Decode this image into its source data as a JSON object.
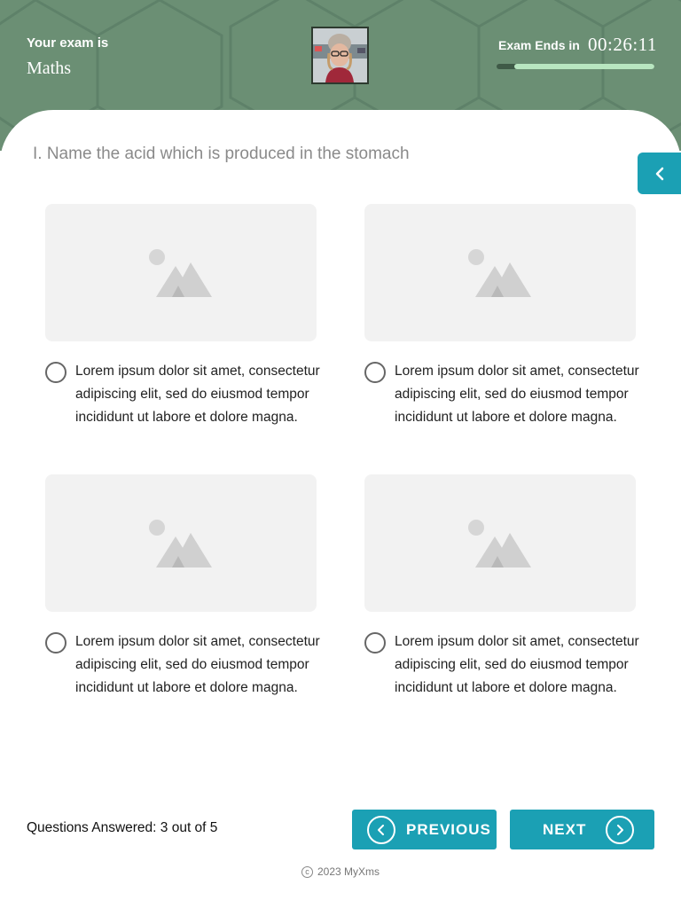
{
  "header": {
    "exam_label": "Your exam is",
    "exam_subject": "Maths",
    "timer_label": "Exam Ends in",
    "timer_value": "00:26:11",
    "time_remaining_fraction": 0.89,
    "avatar_icon": "user-photo"
  },
  "question": {
    "text": "I. Name the acid which is produced in the stomach"
  },
  "options": [
    {
      "text": "Lorem ipsum dolor sit amet, consectetur adipiscing elit, sed do eiusmod tempor incididunt ut labore et dolore magna.",
      "image_icon": "image-placeholder-icon"
    },
    {
      "text": "Lorem ipsum dolor sit amet, consectetur adipiscing elit, sed do eiusmod tempor incididunt ut labore et dolore magna.",
      "image_icon": "image-placeholder-icon"
    },
    {
      "text": "Lorem ipsum dolor sit amet, consectetur adipiscing elit, sed do eiusmod tempor incididunt ut labore et dolore magna.",
      "image_icon": "image-placeholder-icon"
    },
    {
      "text": "Lorem ipsum dolor sit amet, consectetur adipiscing elit, sed do eiusmod tempor incididunt ut labore et dolore magna.",
      "image_icon": "image-placeholder-icon"
    }
  ],
  "footer_bar": {
    "answered_text": "Questions Answered: 3 out of 5",
    "previous_label": "PREVIOUS",
    "next_label": "NEXT"
  },
  "footer": {
    "copyright_symbol": "c",
    "copyright_text": "2023  MyXms"
  },
  "colors": {
    "header_bg": "#6b8f74",
    "accent": "#1ba0b4",
    "timer_fill": "#b8e6c0"
  }
}
